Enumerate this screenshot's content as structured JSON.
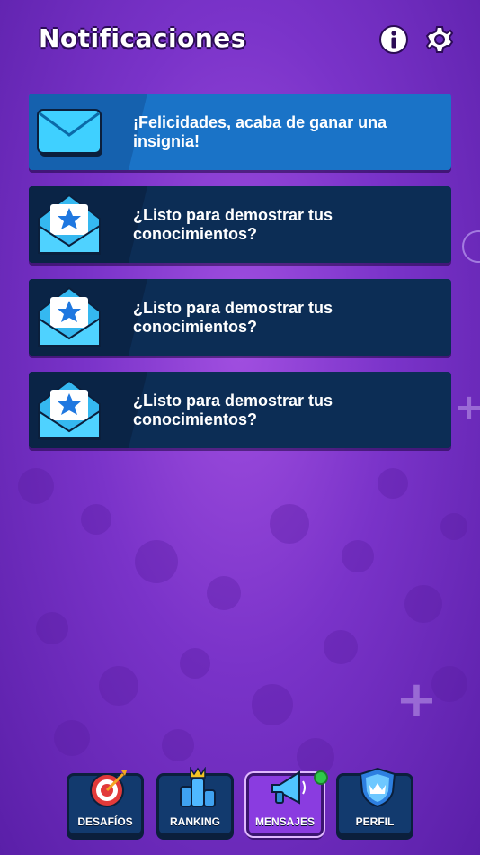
{
  "header": {
    "title": "Notificaciones",
    "info_icon": "info-icon",
    "settings_icon": "gear-icon"
  },
  "notifications": [
    {
      "text": "¡Felicidades, acaba de ganar una insignia!",
      "icon": "closed-envelope-icon",
      "highlighted": true
    },
    {
      "text": "¿Listo para demostrar tus conocimientos?",
      "icon": "open-envelope-star-icon",
      "highlighted": false
    },
    {
      "text": "¿Listo para demostrar tus conocimientos?",
      "icon": "open-envelope-star-icon",
      "highlighted": false
    },
    {
      "text": "¿Listo para demostrar tus conocimientos?",
      "icon": "open-envelope-star-icon",
      "highlighted": false
    }
  ],
  "nav": {
    "items": [
      {
        "label": "DESAFÍOS",
        "icon": "target-icon",
        "active": false
      },
      {
        "label": "RANKING",
        "icon": "crown-podium-icon",
        "active": false
      },
      {
        "label": "MENSAJES",
        "icon": "megaphone-icon",
        "active": true,
        "badge": true
      },
      {
        "label": "PERFIL",
        "icon": "shield-crown-icon",
        "active": false
      }
    ]
  },
  "colors": {
    "background": "#8a3ce0",
    "card": "#0c2d55",
    "card_highlight": "#1a73c7",
    "nav_button": "#123a6e",
    "nav_active": "#8a3ce0",
    "badge": "#2ec84a"
  }
}
